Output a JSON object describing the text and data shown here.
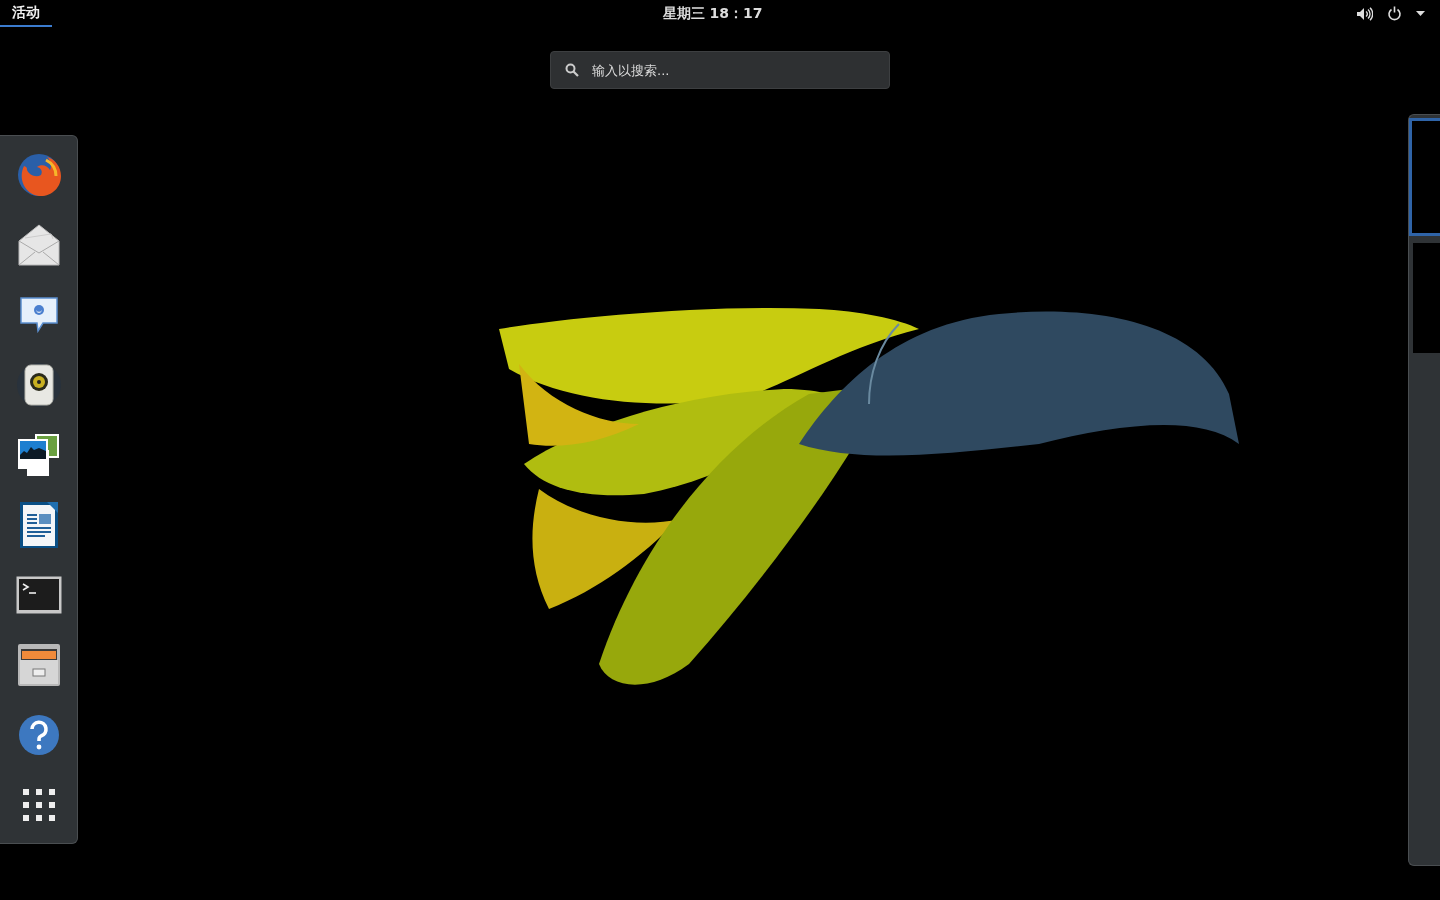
{
  "top_bar": {
    "activities": {
      "label": "活动",
      "selected": true
    },
    "clock": "星期三 18：17"
  },
  "search": {
    "placeholder": "输入以搜索..."
  },
  "dock": [
    {
      "kind": "browser"
    },
    {
      "kind": "mail"
    },
    {
      "kind": "chat"
    },
    {
      "kind": "music"
    },
    {
      "kind": "photos"
    },
    {
      "kind": "document"
    },
    {
      "kind": "terminal"
    },
    {
      "kind": "files"
    },
    {
      "kind": "help"
    },
    {
      "kind": "apps"
    }
  ],
  "workspaces": [
    {
      "selected": true
    },
    {
      "selected": false
    }
  ]
}
